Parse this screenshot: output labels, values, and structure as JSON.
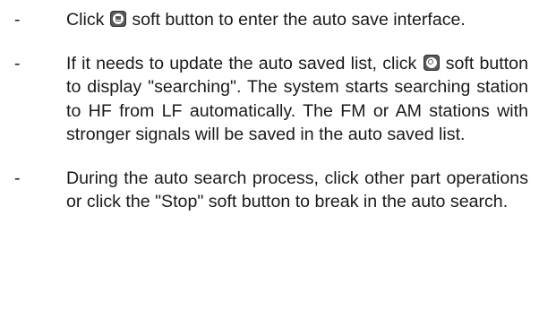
{
  "bullet_marker": "-",
  "items": [
    {
      "before_icon": "Click",
      "icon": "list-icon",
      "after_icon": "soft button to enter the auto save interface."
    },
    {
      "before_icon": "If it needs to update the auto saved list, click",
      "icon": "search-icon",
      "after_icon": "soft button to display \"searching\". The system starts searching station to HF from LF automatically. The FM or AM stations with stronger signals will be saved in the auto saved list."
    },
    {
      "text": "During the auto search process, click other part operations or click the \"Stop\" soft button to break in the auto search."
    }
  ]
}
